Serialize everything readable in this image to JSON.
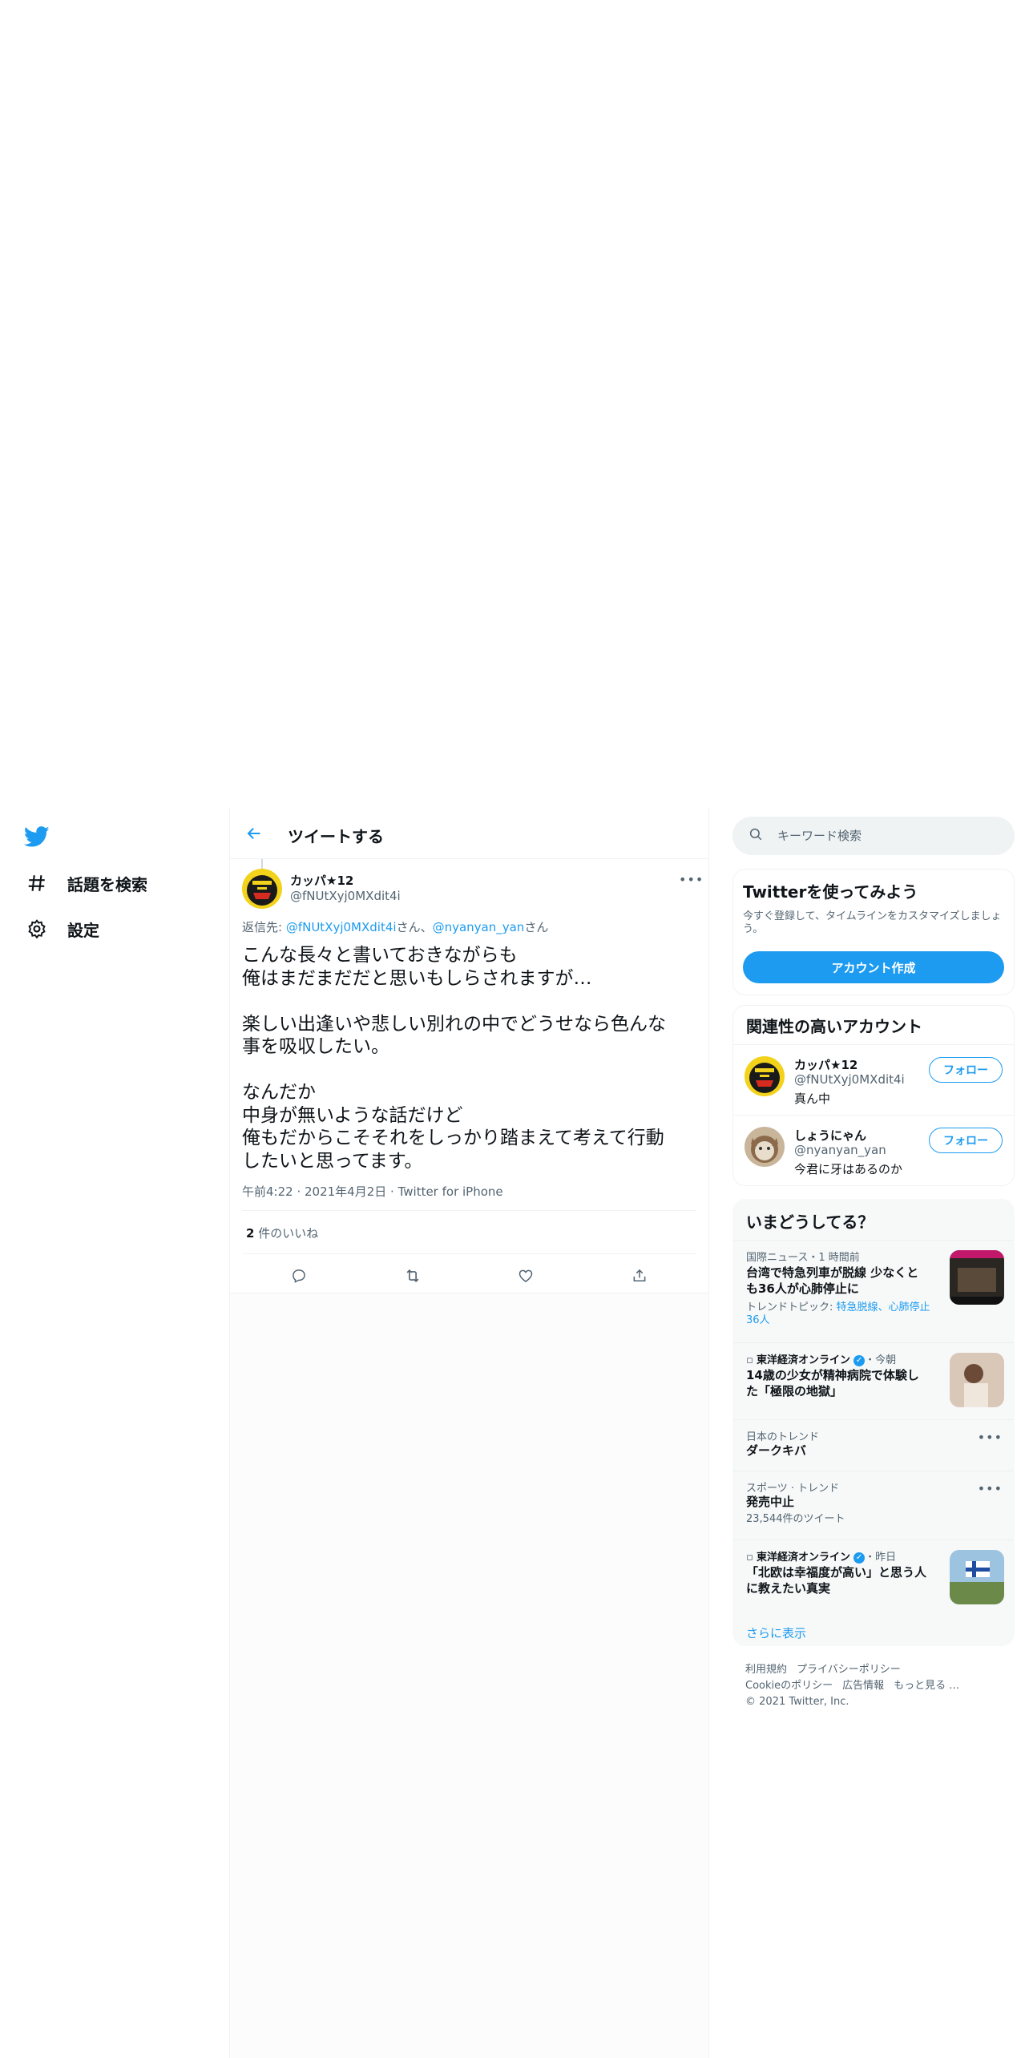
{
  "nav": {
    "items": [
      {
        "label": "話題を検索",
        "icon": "hashtag-icon"
      },
      {
        "label": "設定",
        "icon": "gear-icon"
      }
    ]
  },
  "header": {
    "title": "ツイートする"
  },
  "tweet": {
    "author_name": "カッパ★12",
    "author_handle": "@fNUtXyj0MXdit4i",
    "reply_prefix": "返信先: ",
    "reply_user1": "@fNUtXyj0MXdit4i",
    "reply_suffix1": "さん、",
    "reply_user2": "@nyanyan_yan",
    "reply_suffix2": "さん",
    "lines": [
      "こんな長々と書いておきながらも",
      "俺はまだまだだと思いもしらされますが…",
      "",
      "楽しい出逢いや悲しい別れの中でどうせなら色んな",
      "事を吸収したい。",
      "",
      "なんだか",
      "中身が無いような話だけど",
      "俺もだからこそそれをしっかり踏まえて考えて行動",
      "したいと思ってます。"
    ],
    "time": "午前4:22",
    "sep": " · ",
    "date": "2021年4月2日",
    "source": "Twitter for iPhone",
    "like_count": "2",
    "like_label": " 件のいいね"
  },
  "search": {
    "placeholder": "キーワード検索"
  },
  "signup": {
    "title": "Twitterを使ってみよう",
    "desc": "今すぐ登録して、タイムラインをカスタマイズしましょう。",
    "button": "アカウント作成"
  },
  "related": {
    "title": "関連性の高いアカウント",
    "accounts": [
      {
        "name": "カッパ★12",
        "handle": "@fNUtXyj0MXdit4i",
        "bio": "真ん中",
        "follow": "フォロー"
      },
      {
        "name": "しょうにゃん",
        "handle": "@nyanyan_yan",
        "bio": "今君に牙はあるのか",
        "follow": "フォロー"
      }
    ]
  },
  "trends": {
    "title": "いまどうしてる？",
    "items": [
      {
        "context": "国際ニュース・1 時間前",
        "title": "台湾で特急列車が脱線 少なくとも36人が心肺停止に",
        "sub_prefix": "トレンドトピック: ",
        "sub_links": "特急脱線、心肺停止36人"
      },
      {
        "source": "東洋経済オンライン",
        "when": "・今朝",
        "title": "14歳の少女が精神病院で体験した「極限の地獄」"
      },
      {
        "context": "日本のトレンド",
        "title": "ダークキバ"
      },
      {
        "context": "スポーツ · トレンド",
        "title": "発売中止",
        "count": "23,544件のツイート"
      },
      {
        "source": "東洋経済オンライン",
        "when": "・昨日",
        "title": "「北欧は幸福度が高い」と思う人に教えたい真実"
      }
    ],
    "show_more": "さらに表示"
  },
  "footer": {
    "links": [
      "利用規約",
      "プライバシーポリシー",
      "Cookieのポリシー",
      "広告情報",
      "もっと見る …"
    ],
    "copyright": "© 2021 Twitter, Inc."
  },
  "colors": {
    "accent": "#1d9bf0",
    "text": "#0f1419",
    "muted": "#536471",
    "border": "#eff3f4"
  }
}
